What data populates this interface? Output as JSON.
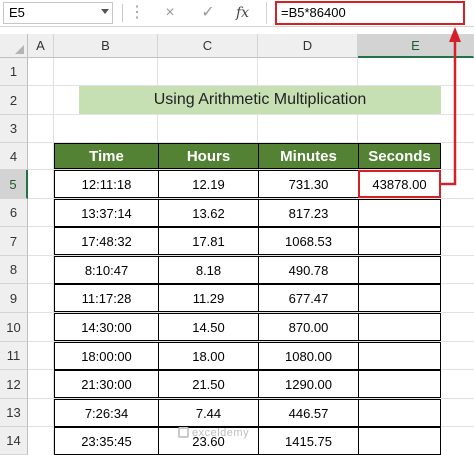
{
  "formula_bar": {
    "name_box": "E5",
    "cancel_icon": "×",
    "enter_icon": "✓",
    "fx_label": "fx",
    "formula": "=B5*86400"
  },
  "columns": [
    "A",
    "B",
    "C",
    "D",
    "E"
  ],
  "rows": [
    "1",
    "2",
    "3",
    "4",
    "5",
    "6",
    "7",
    "8",
    "9",
    "10",
    "11",
    "12",
    "13",
    "14"
  ],
  "selected_column": "E",
  "selected_row": "5",
  "title": "Using Arithmetic Multiplication",
  "table": {
    "headers": [
      "Time",
      "Hours",
      "Minutes",
      "Seconds"
    ],
    "rows": [
      [
        "12:11:18",
        "12.19",
        "731.30",
        "43878.00"
      ],
      [
        "13:37:14",
        "13.62",
        "817.23",
        ""
      ],
      [
        "17:48:32",
        "17.81",
        "1068.53",
        ""
      ],
      [
        "8:10:47",
        "8.18",
        "490.78",
        ""
      ],
      [
        "11:17:28",
        "11.29",
        "677.47",
        ""
      ],
      [
        "14:30:00",
        "14.50",
        "870.00",
        ""
      ],
      [
        "18:00:00",
        "18.00",
        "1080.00",
        ""
      ],
      [
        "21:30:00",
        "21.50",
        "1290.00",
        ""
      ],
      [
        "7:26:34",
        "7.44",
        "446.57",
        ""
      ],
      [
        "23:35:45",
        "23.60",
        "1415.75",
        ""
      ]
    ]
  },
  "watermark": "exceldemy",
  "colors": {
    "header_fill": "#548235",
    "title_fill": "#c6e0b4",
    "highlight": "#d42127",
    "selection": "#217346"
  }
}
